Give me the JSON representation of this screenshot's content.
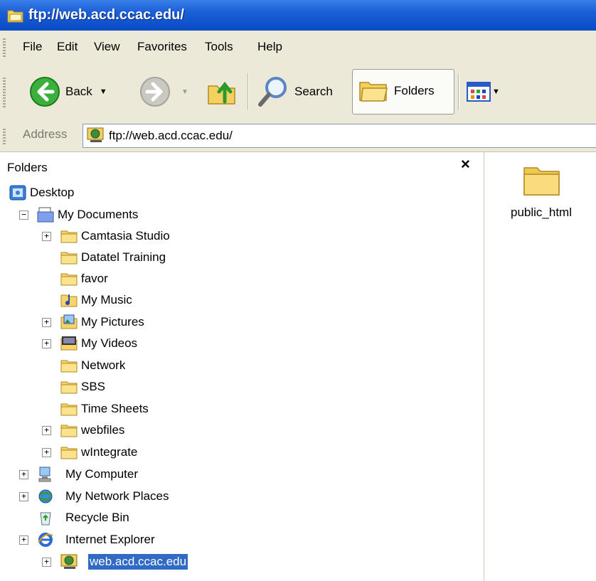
{
  "window": {
    "title": "ftp://web.acd.ccac.edu/",
    "icon": "ftp-folder-icon"
  },
  "menu": [
    "File",
    "Edit",
    "View",
    "Favorites",
    "Tools",
    "Help"
  ],
  "toolbar": {
    "back_label": "Back",
    "search_label": "Search",
    "folders_label": "Folders",
    "icons": [
      "back-arrow-icon",
      "forward-arrow-icon",
      "up-folder-icon",
      "search-magnifier-icon",
      "folders-icon",
      "views-icon"
    ]
  },
  "address": {
    "label": "Address",
    "value": "ftp://web.acd.ccac.edu/"
  },
  "folders_pane": {
    "title": "Folders",
    "close_glyph": "×",
    "tree": [
      {
        "label": "Desktop"
      },
      {
        "label": "My Documents"
      },
      {
        "label": "Camtasia Studio"
      },
      {
        "label": "Datatel Training"
      },
      {
        "label": "favor"
      },
      {
        "label": "My Music"
      },
      {
        "label": "My Pictures"
      },
      {
        "label": "My Videos"
      },
      {
        "label": "Network"
      },
      {
        "label": "SBS"
      },
      {
        "label": "Time Sheets"
      },
      {
        "label": "webfiles"
      },
      {
        "label": "wIntegrate"
      },
      {
        "label": "My Computer"
      },
      {
        "label": "My Network Places"
      },
      {
        "label": "Recycle Bin"
      },
      {
        "label": "Internet Explorer"
      },
      {
        "label": "web.acd.ccac.edu"
      }
    ],
    "expander_plus": "+",
    "expander_minus": "−"
  },
  "files": [
    {
      "label": "public_html",
      "icon": "folder-icon"
    }
  ],
  "colors": {
    "titlebar": "#0a4bc6",
    "chrome": "#ece9d8",
    "selection": "#316ac5",
    "folder": "#f6d46a"
  }
}
